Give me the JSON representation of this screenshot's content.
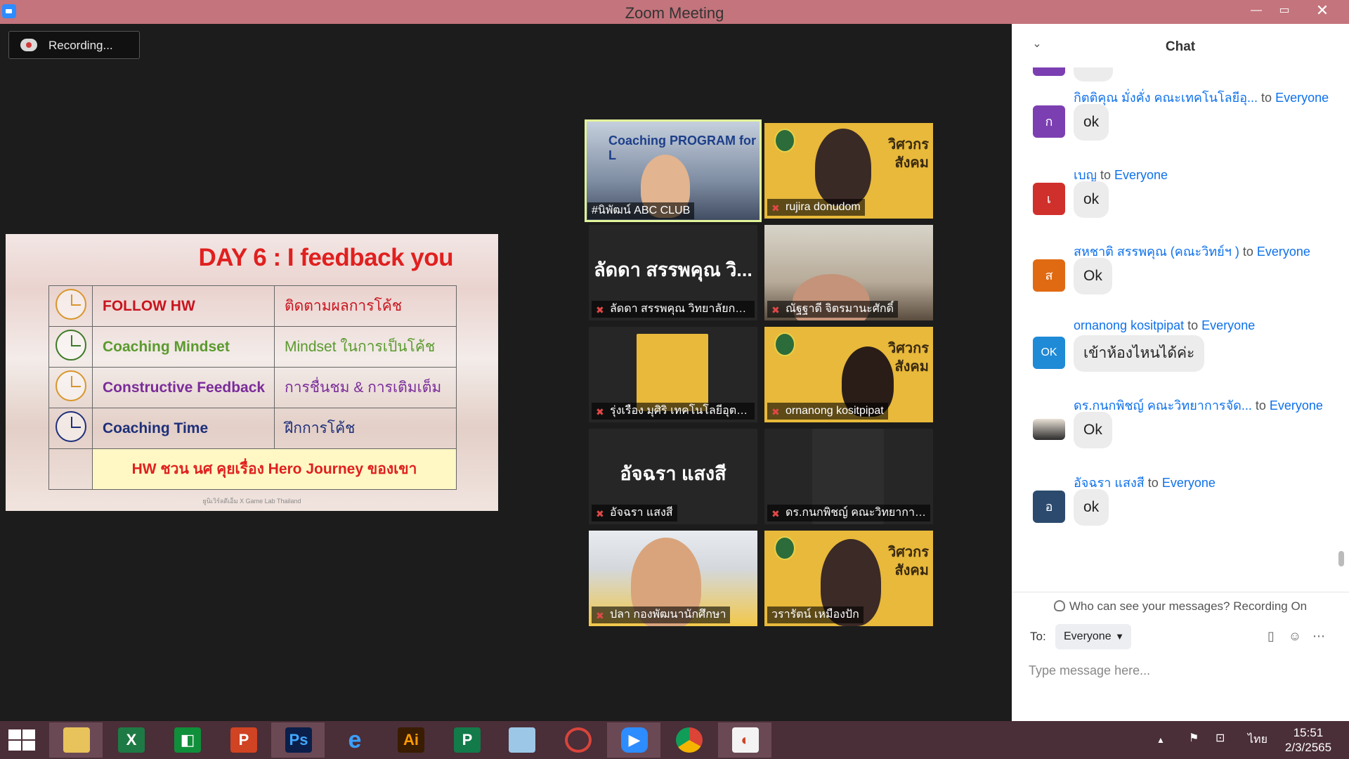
{
  "window": {
    "title": "Zoom Meeting",
    "minimize": "—",
    "maximize": "▭",
    "close": "✕"
  },
  "recording": {
    "label": "Recording..."
  },
  "slide": {
    "title": "DAY 6 : I feedback you",
    "rows": [
      {
        "en": "FOLLOW HW",
        "th": "ติดตามผลการโค้ช",
        "color": "#c8141e",
        "clock_color": "#d8962c"
      },
      {
        "en": "Coaching Mindset",
        "th": "Mindset ในการเป็นโค้ช",
        "color": "#5a9a2e",
        "clock_color": "#3e7a26"
      },
      {
        "en": "Constructive Feedback",
        "th": "การชื่นชม & การเติมเต็ม",
        "color": "#7a2c9a",
        "clock_color": "#d8962c"
      },
      {
        "en": "Coaching Time",
        "th": "ฝึกการโค้ช",
        "color": "#1d2f7a",
        "clock_color": "#1d2f7a"
      }
    ],
    "hw_text": "HW ชวน นศ คุยเรื่อง Hero Journey ของเขา",
    "footer": "ยูนิเวิร์ลดีเอ็ม X Game Lab Thailand"
  },
  "participants": [
    {
      "name": "#นิพัฒน์ ABC CLUB",
      "muted": false,
      "overlay": "Coaching PROGRAM for L"
    },
    {
      "name": "rujira donudom",
      "muted": true,
      "banner": "วิศวกร สังคม"
    },
    {
      "name": "ลัดดา สรรพคุณ วิทยาลัยกา...",
      "muted": true,
      "display": "ลัดดา สรรพคุณ วิ..."
    },
    {
      "name": "ณัฐฐาดี จิตรมานะศักดิ์",
      "muted": true
    },
    {
      "name": "รุ่งเรือง มุศิริ เทคโนโลยีอุตสา...",
      "muted": true
    },
    {
      "name": "ornanong kositpipat",
      "muted": true,
      "banner": "วิศวกร สังคม"
    },
    {
      "name": "อัจฉรา แสงสี",
      "muted": true,
      "display": "อัจฉรา แสงสี"
    },
    {
      "name": "ดร.กนกพิชญ์ คณะวิทยาการ...",
      "muted": true
    },
    {
      "name": "ปลา กองพัฒนานักศึกษา",
      "muted": true
    },
    {
      "name": "วรารัตน์ เหมืองปัก",
      "muted": false,
      "banner": "วิศวกร สังคม"
    }
  ],
  "chat": {
    "title": "Chat",
    "messages": [
      {
        "sender": "กิตติคุณ มั่งคั่ง คณะเทคโนโลยีอุ...",
        "to_word": "to",
        "recipient": "Everyone",
        "avatar": "ก",
        "avatar_color": "#7c3fb2",
        "text": "ok"
      },
      {
        "sender": "เบญ",
        "to_word": "to",
        "recipient": "Everyone",
        "avatar": "เ",
        "avatar_color": "#d0302c",
        "text": "ok"
      },
      {
        "sender": "สหชาติ สรรพคุณ (คณะวิทย์ฯ )",
        "to_word": "to",
        "recipient": "Everyone",
        "avatar": "ส",
        "avatar_color": "#e06a12",
        "text": "Ok"
      },
      {
        "sender": "ornanong kositpipat",
        "to_word": "to",
        "recipient": "Everyone",
        "avatar": "OK",
        "avatar_color": "#1f8ad6",
        "text": "เข้าห้องไหนได้ค่ะ"
      },
      {
        "sender": "ดร.กนกพิชญ์ คณะวิทยาการจัด...",
        "to_word": "to",
        "recipient": "Everyone",
        "avatar": "",
        "avatar_color": "#c9a77a",
        "text": "Ok"
      },
      {
        "sender": "อัจฉรา แสงสี",
        "to_word": "to",
        "recipient": "Everyone",
        "avatar": "อ",
        "avatar_color": "#2b4a6e",
        "text": "ok"
      }
    ],
    "visibility": "Who can see your messages? Recording On",
    "to_label": "To:",
    "to_value": "Everyone",
    "input_placeholder": "Type message here..."
  },
  "taskbar": {
    "apps": [
      "file-explorer",
      "excel",
      "publisher-green",
      "powerpoint",
      "photoshop",
      "internet-explorer",
      "illustrator",
      "project",
      "notepad",
      "photoscape",
      "zoom",
      "chrome",
      "office-lens"
    ],
    "language": "ไทย",
    "time": "15:51",
    "date": "2/3/2565"
  }
}
